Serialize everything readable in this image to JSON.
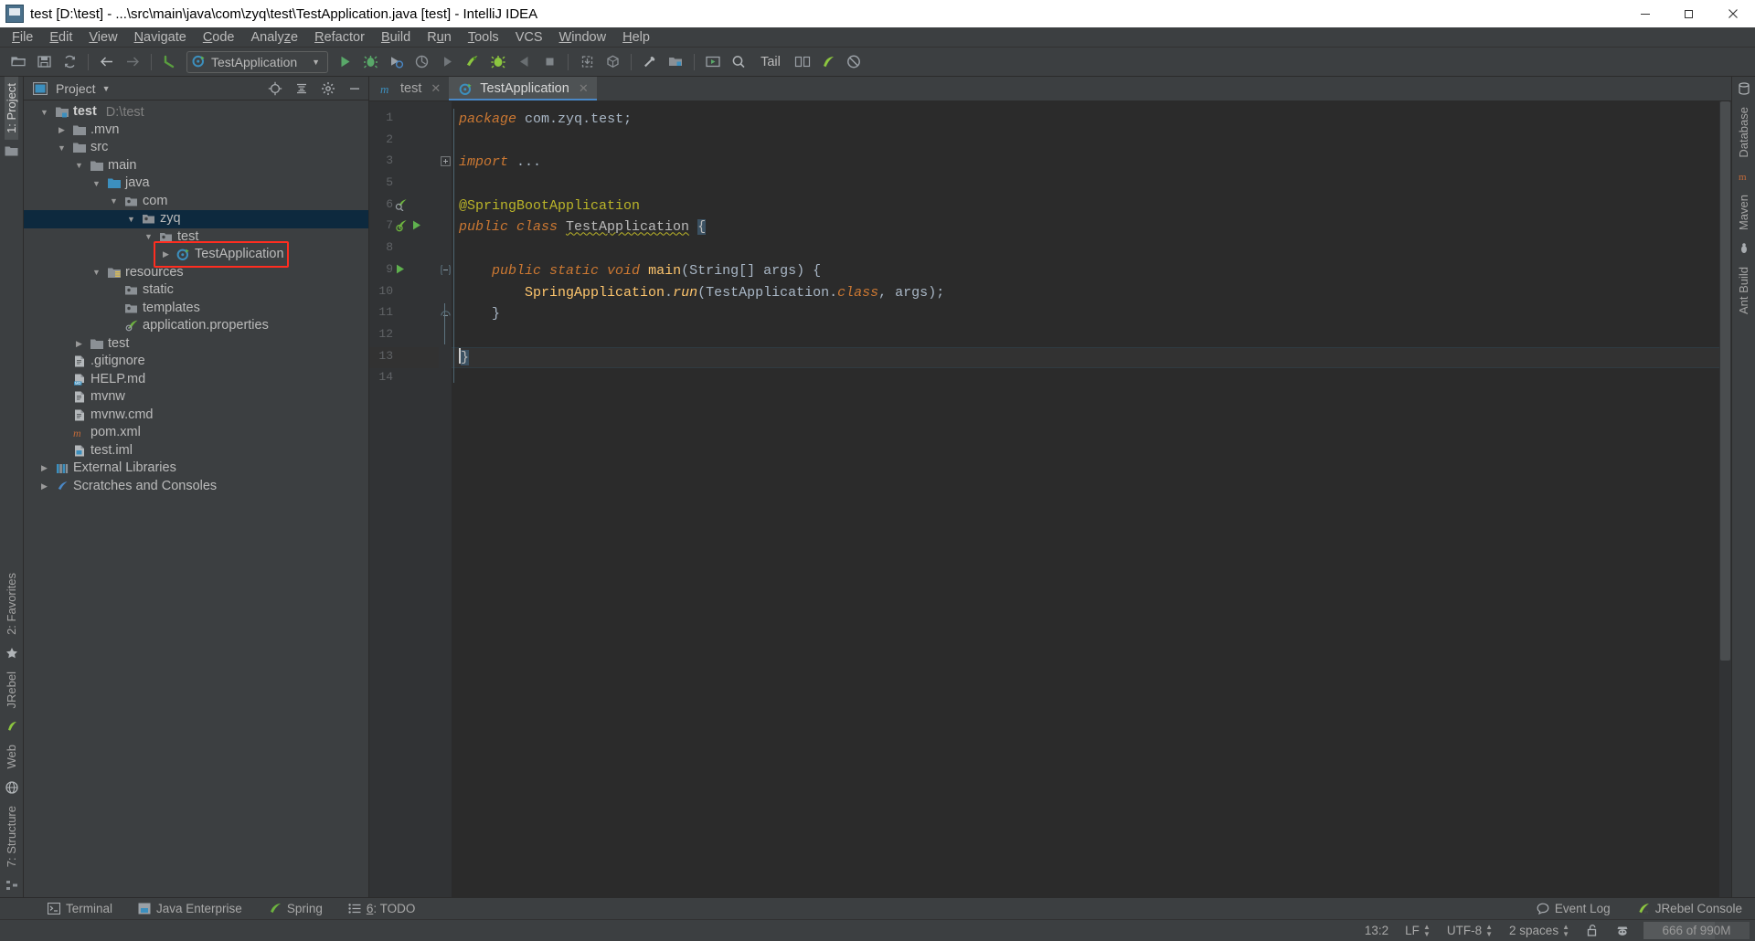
{
  "window": {
    "title": "test [D:\\test] - ...\\src\\main\\java\\com\\zyq\\test\\TestApplication.java [test] - IntelliJ IDEA",
    "minimize_label": "Minimize",
    "maximize_label": "Restore",
    "close_label": "Close"
  },
  "menubar": {
    "items": [
      {
        "label": "File",
        "mnemonic": "F"
      },
      {
        "label": "Edit",
        "mnemonic": "E"
      },
      {
        "label": "View",
        "mnemonic": "V"
      },
      {
        "label": "Navigate",
        "mnemonic": "N"
      },
      {
        "label": "Code",
        "mnemonic": "C"
      },
      {
        "label": "Analyze",
        "mnemonic": "z"
      },
      {
        "label": "Refactor",
        "mnemonic": "R"
      },
      {
        "label": "Build",
        "mnemonic": "B"
      },
      {
        "label": "Run",
        "mnemonic": "u"
      },
      {
        "label": "Tools",
        "mnemonic": "T"
      },
      {
        "label": "VCS",
        "mnemonic": ""
      },
      {
        "label": "Window",
        "mnemonic": "W"
      },
      {
        "label": "Help",
        "mnemonic": "H"
      }
    ]
  },
  "toolbar": {
    "run_config": "TestApplication",
    "tail_label": "Tail",
    "buttons": [
      "open-folder",
      "save-all",
      "sync",
      "back",
      "forward",
      "undo",
      "run",
      "debug",
      "run-with-coverage",
      "profile",
      "rerun",
      "jrebel-run",
      "jrebel-debug",
      "stop-jrebel",
      "stop",
      "update-app",
      "build-artifact",
      "settings",
      "project-structure",
      "run-anything",
      "search-everywhere"
    ]
  },
  "left_strip": {
    "top_tab": "1: Project",
    "bottom_tabs": [
      "2: Favorites",
      "JRebel",
      "Web",
      "7: Structure"
    ]
  },
  "right_strip": {
    "tabs": [
      "Database",
      "Maven",
      "Ant Build"
    ]
  },
  "project_panel": {
    "title": "Project",
    "locate_button": "Select Opened File",
    "collapse_button": "Collapse All",
    "settings_button": "Settings",
    "hide_button": "Hide",
    "tree": [
      {
        "label": "test",
        "suffix": "D:\\test",
        "depth": 0,
        "arrow": "down",
        "icon": "module-folder",
        "bold": true,
        "selected": false
      },
      {
        "label": ".mvn",
        "suffix": "",
        "depth": 1,
        "arrow": "right",
        "icon": "folder",
        "bold": false,
        "selected": false
      },
      {
        "label": "src",
        "suffix": "",
        "depth": 1,
        "arrow": "down",
        "icon": "folder",
        "bold": false,
        "selected": false
      },
      {
        "label": "main",
        "suffix": "",
        "depth": 2,
        "arrow": "down",
        "icon": "folder",
        "bold": false,
        "selected": false
      },
      {
        "label": "java",
        "suffix": "",
        "depth": 3,
        "arrow": "down",
        "icon": "source-root",
        "bold": false,
        "selected": false
      },
      {
        "label": "com",
        "suffix": "",
        "depth": 4,
        "arrow": "down",
        "icon": "package",
        "bold": false,
        "selected": false
      },
      {
        "label": "zyq",
        "suffix": "",
        "depth": 5,
        "arrow": "down",
        "icon": "package",
        "bold": false,
        "selected": true
      },
      {
        "label": "test",
        "suffix": "",
        "depth": 6,
        "arrow": "down",
        "icon": "package",
        "bold": false,
        "selected": false
      },
      {
        "label": "TestApplication",
        "suffix": "",
        "depth": 7,
        "arrow": "right",
        "icon": "spring-class",
        "bold": false,
        "selected": false,
        "annotated": true
      },
      {
        "label": "resources",
        "suffix": "",
        "depth": 3,
        "arrow": "down",
        "icon": "resource-root",
        "bold": false,
        "selected": false
      },
      {
        "label": "static",
        "suffix": "",
        "depth": 4,
        "arrow": "none",
        "icon": "package",
        "bold": false,
        "selected": false
      },
      {
        "label": "templates",
        "suffix": "",
        "depth": 4,
        "arrow": "none",
        "icon": "package",
        "bold": false,
        "selected": false
      },
      {
        "label": "application.properties",
        "suffix": "",
        "depth": 4,
        "arrow": "none",
        "icon": "spring-properties",
        "bold": false,
        "selected": false
      },
      {
        "label": "test",
        "suffix": "",
        "depth": 2,
        "arrow": "right",
        "icon": "folder",
        "bold": false,
        "selected": false
      },
      {
        "label": ".gitignore",
        "suffix": "",
        "depth": 1,
        "arrow": "none",
        "icon": "file-text",
        "bold": false,
        "selected": false
      },
      {
        "label": "HELP.md",
        "suffix": "",
        "depth": 1,
        "arrow": "none",
        "icon": "file-md",
        "bold": false,
        "selected": false
      },
      {
        "label": "mvnw",
        "suffix": "",
        "depth": 1,
        "arrow": "none",
        "icon": "file-text",
        "bold": false,
        "selected": false
      },
      {
        "label": "mvnw.cmd",
        "suffix": "",
        "depth": 1,
        "arrow": "none",
        "icon": "file-text",
        "bold": false,
        "selected": false
      },
      {
        "label": "pom.xml",
        "suffix": "",
        "depth": 1,
        "arrow": "none",
        "icon": "maven-pom",
        "bold": false,
        "selected": false
      },
      {
        "label": "test.iml",
        "suffix": "",
        "depth": 1,
        "arrow": "none",
        "icon": "file-iml",
        "bold": false,
        "selected": false
      },
      {
        "label": "External Libraries",
        "suffix": "",
        "depth": 0,
        "arrow": "right",
        "icon": "libraries",
        "bold": false,
        "selected": false
      },
      {
        "label": "Scratches and Consoles",
        "suffix": "",
        "depth": 0,
        "arrow": "right",
        "icon": "scratches",
        "bold": false,
        "selected": false
      }
    ]
  },
  "editor": {
    "tabs": [
      {
        "label": "test",
        "icon": "maven-m",
        "active": false
      },
      {
        "label": "TestApplication",
        "icon": "spring-class",
        "active": true
      }
    ],
    "lines": [
      {
        "num": "1",
        "gutter_icons": [],
        "fold": "none",
        "cursor": false,
        "tokens": [
          {
            "t": "package ",
            "c": "kwi"
          },
          {
            "t": "com",
            "c": "pkg"
          },
          {
            "t": ".",
            "c": "pun"
          },
          {
            "t": "zyq",
            "c": "pkg"
          },
          {
            "t": ".",
            "c": "pun"
          },
          {
            "t": "test",
            "c": "pkg"
          },
          {
            "t": ";",
            "c": "pun"
          }
        ]
      },
      {
        "num": "2",
        "gutter_icons": [],
        "fold": "none",
        "cursor": false,
        "tokens": []
      },
      {
        "num": "3",
        "gutter_icons": [],
        "fold": "plus",
        "cursor": false,
        "tokens": [
          {
            "t": "import ",
            "c": "kwi"
          },
          {
            "t": "...",
            "c": "pun"
          }
        ]
      },
      {
        "num": "5",
        "gutter_icons": [],
        "fold": "none",
        "cursor": false,
        "tokens": []
      },
      {
        "num": "6",
        "gutter_icons": [
          "spring-bean"
        ],
        "fold": "none",
        "cursor": false,
        "tokens": [
          {
            "t": "@SpringBootApplication",
            "c": "ann"
          }
        ]
      },
      {
        "num": "7",
        "gutter_icons": [
          "spring-boot",
          "run-arrow"
        ],
        "fold": "none",
        "cursor": false,
        "tokens": [
          {
            "t": "public ",
            "c": "kwi"
          },
          {
            "t": "class ",
            "c": "kwi"
          },
          {
            "t": "TestApplication",
            "c": "wavy"
          },
          {
            "t": " ",
            "c": "pun"
          },
          {
            "t": "{",
            "c": "selbrace"
          }
        ]
      },
      {
        "num": "8",
        "gutter_icons": [],
        "fold": "none",
        "cursor": false,
        "tokens": []
      },
      {
        "num": "9",
        "gutter_icons": [
          "run-arrow"
        ],
        "fold": "minus",
        "cursor": false,
        "tokens": [
          {
            "t": "    public ",
            "c": "kwi"
          },
          {
            "t": "static ",
            "c": "kwi"
          },
          {
            "t": "void ",
            "c": "kwi"
          },
          {
            "t": "main",
            "c": "mth"
          },
          {
            "t": "(",
            "c": "pun"
          },
          {
            "t": "String",
            "c": "cls"
          },
          {
            "t": "[] ",
            "c": "pun"
          },
          {
            "t": "args",
            "c": "param"
          },
          {
            "t": ") {",
            "c": "pun"
          }
        ]
      },
      {
        "num": "10",
        "gutter_icons": [],
        "fold": "none",
        "cursor": false,
        "tokens": [
          {
            "t": "        SpringApplication",
            "c": "mth"
          },
          {
            "t": ".",
            "c": "pun"
          },
          {
            "t": "run",
            "c": "mthi"
          },
          {
            "t": "(",
            "c": "pun"
          },
          {
            "t": "TestApplication",
            "c": "cls"
          },
          {
            "t": ".",
            "c": "pun"
          },
          {
            "t": "class",
            "c": "kwi"
          },
          {
            "t": ", ",
            "c": "pun"
          },
          {
            "t": "args",
            "c": "param"
          },
          {
            "t": ");",
            "c": "pun"
          }
        ]
      },
      {
        "num": "11",
        "gutter_icons": [],
        "fold": "endminus",
        "cursor": false,
        "tokens": [
          {
            "t": "    }",
            "c": "pun"
          }
        ]
      },
      {
        "num": "12",
        "gutter_icons": [],
        "fold": "none",
        "cursor": false,
        "tokens": []
      },
      {
        "num": "13",
        "gutter_icons": [],
        "fold": "none",
        "cursor": true,
        "tokens": [
          {
            "t": "}",
            "c": "selbrace"
          }
        ]
      },
      {
        "num": "14",
        "gutter_icons": [],
        "fold": "none",
        "cursor": false,
        "tokens": []
      }
    ]
  },
  "bottom_bar": {
    "windows": [
      {
        "label": "Terminal",
        "mnemonic": "",
        "icon": "terminal-icon"
      },
      {
        "label": "Java Enterprise",
        "mnemonic": "",
        "icon": "jee-icon"
      },
      {
        "label": "Spring",
        "mnemonic": "",
        "icon": "spring-leaf-icon"
      },
      {
        "label": "6: TODO",
        "mnemonic": "6",
        "icon": "todo-icon"
      }
    ],
    "right": [
      {
        "label": "Event Log",
        "icon": "event-log-icon"
      },
      {
        "label": "JRebel Console",
        "icon": "jrebel-icon"
      }
    ]
  },
  "status_bar": {
    "caret": "13:2",
    "line_separator": "LF",
    "encoding": "UTF-8",
    "indent": "2 spaces",
    "lock_icon": "unlocked-icon",
    "hector_icon": "hector-icon",
    "memory": "666 of 990M",
    "memory_percent": 67
  },
  "colors": {
    "accent": "#4a88c7",
    "selection": "#0d293e",
    "annotation": "#ff2d20",
    "editor_bg": "#2b2b2b",
    "panel_bg": "#3c3f41"
  }
}
